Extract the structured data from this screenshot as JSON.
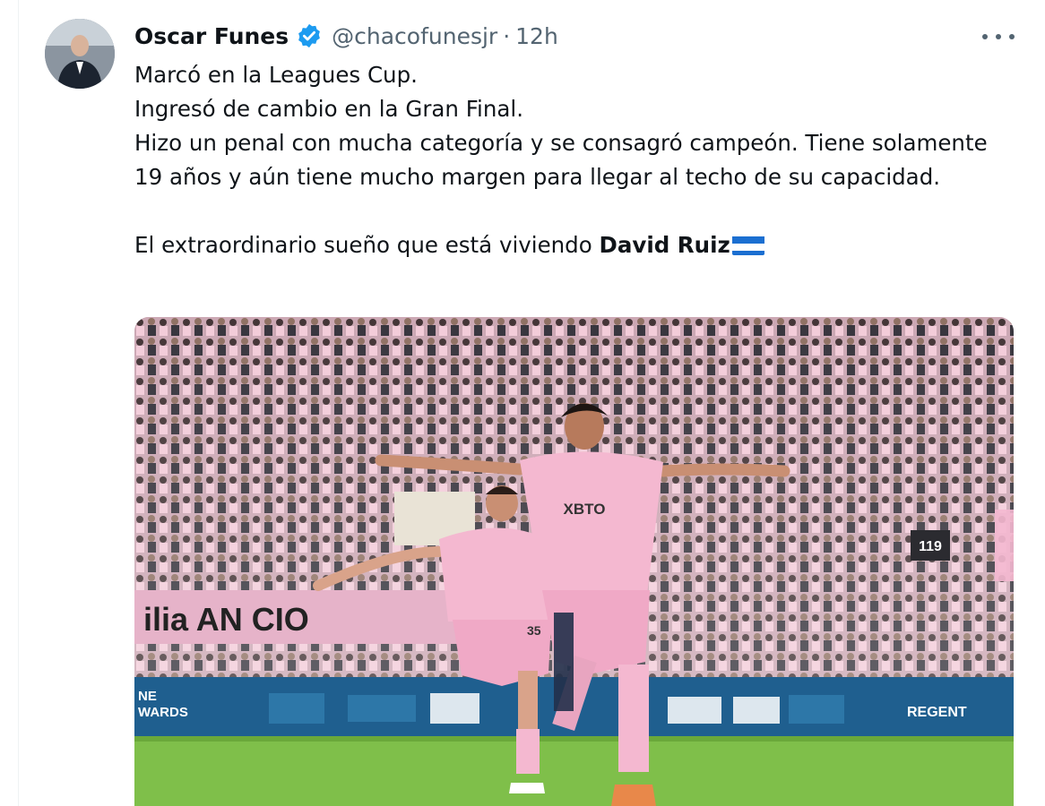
{
  "tweet": {
    "author_name": "Oscar Funes",
    "handle": "@chacofunesjr",
    "separator": "·",
    "time": "12h",
    "verified_icon": "verified-badge-icon",
    "more_icon": "more-options-icon",
    "lines": [
      "Marcó en la Leagues Cup.",
      "Ingresó de cambio en la Gran Final.",
      "Hizo un penal con mucha categoría y se consagró campeón. Tiene solamente 19 años y aún tiene mucho margen para llegar al techo de su capacidad."
    ],
    "closing_text": "El extraordinario sueño que está viviendo ",
    "closing_bold": "David Ruiz",
    "flag_icon": "honduras-flag-icon"
  },
  "media": {
    "jersey_sponsor": "XBTO",
    "jersey_number_left": "35",
    "stand_sign": "119",
    "ad_boards": [
      "NE",
      "WARDS",
      "REGENT"
    ],
    "banner_text": "ilia  AN  CIO"
  },
  "colors": {
    "accent": "#1d9bf0",
    "text": "#0f1419",
    "secondary": "#536471",
    "jersey_pink": "#f4b8d0",
    "pitch_green": "#7fbf4a",
    "board_blue": "#1f5f8f"
  }
}
